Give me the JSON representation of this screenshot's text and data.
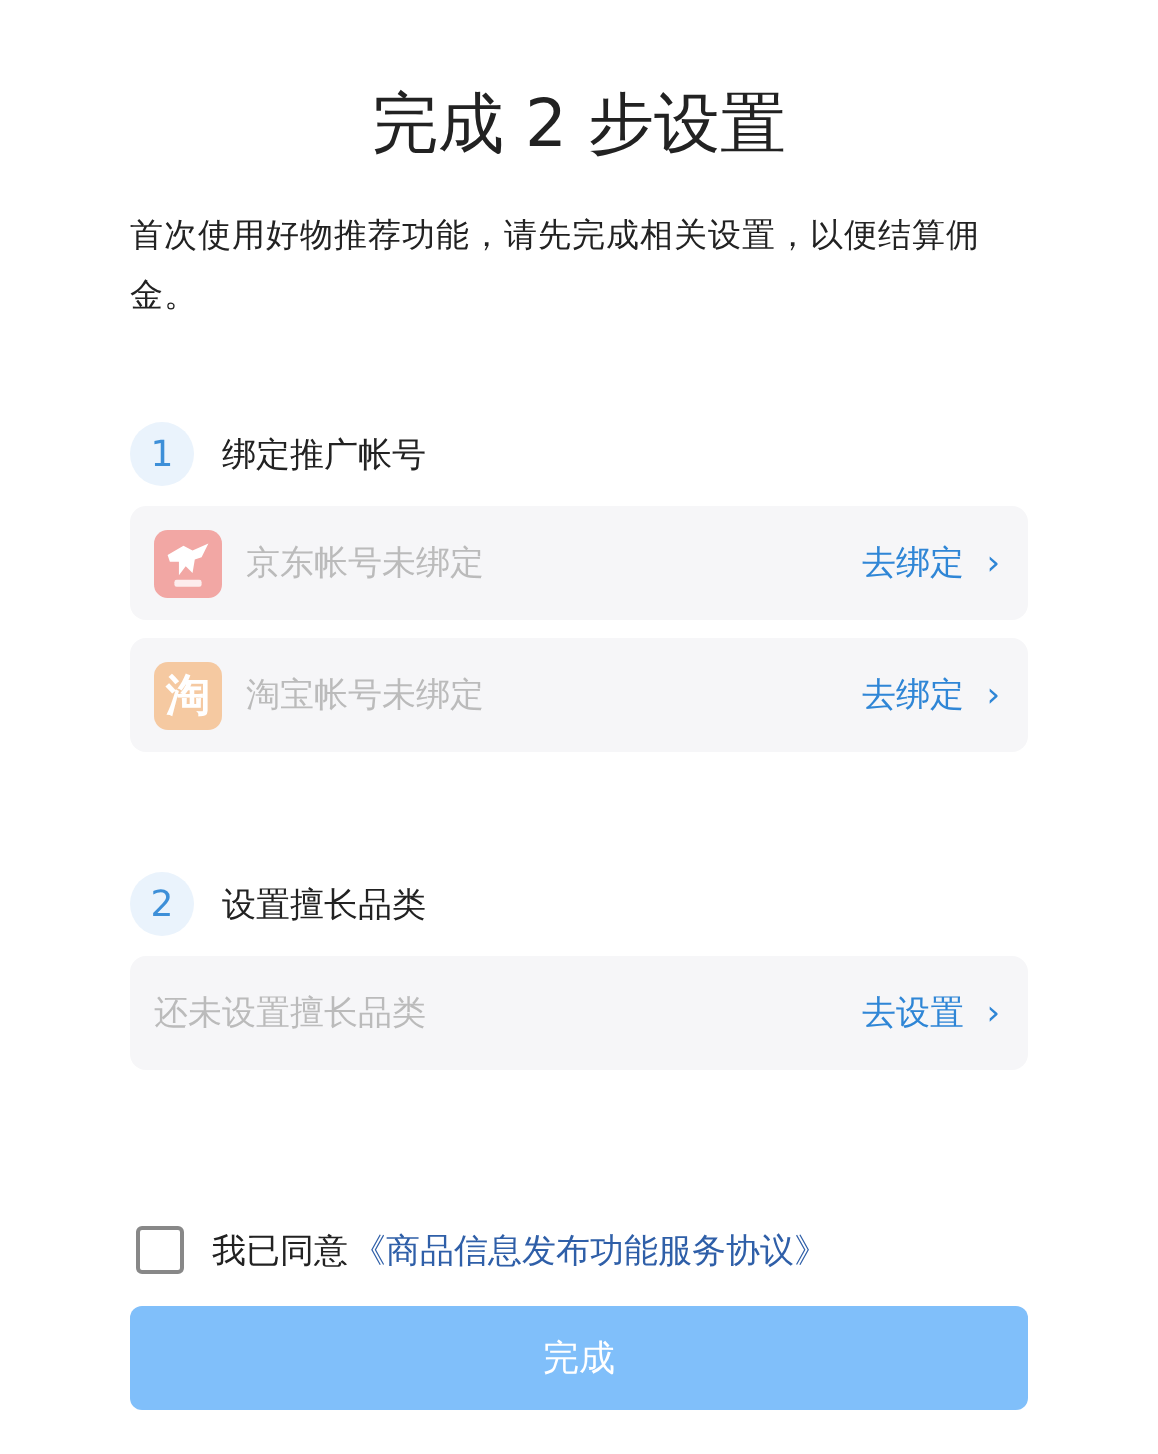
{
  "title": "完成 2 步设置",
  "intro": "首次使用好物推荐功能，请先完成相关设置，以便结算佣金。",
  "steps": [
    {
      "number": "1",
      "label": "绑定推广帐号",
      "rows": [
        {
          "kind": "dog-logo",
          "color": "#f2a7a4",
          "text": "京东帐号未绑定",
          "action": "去绑定",
          "arrow": "›"
        },
        {
          "kind": "glyph-logo",
          "color": "#f5c9a1",
          "glyph": "淘",
          "text": "淘宝帐号未绑定",
          "action": "去绑定",
          "arrow": "›"
        }
      ]
    },
    {
      "number": "2",
      "label": "设置擅长品类",
      "rows": [
        {
          "kind": "plain",
          "text": "还未设置擅长品类",
          "action": "去设置",
          "arrow": "›"
        }
      ]
    }
  ],
  "agreement": {
    "checked": false,
    "prefix": "我已同意",
    "link": "《商品信息发布功能服务协议》"
  },
  "submit": {
    "label": "完成",
    "disabled": true
  }
}
